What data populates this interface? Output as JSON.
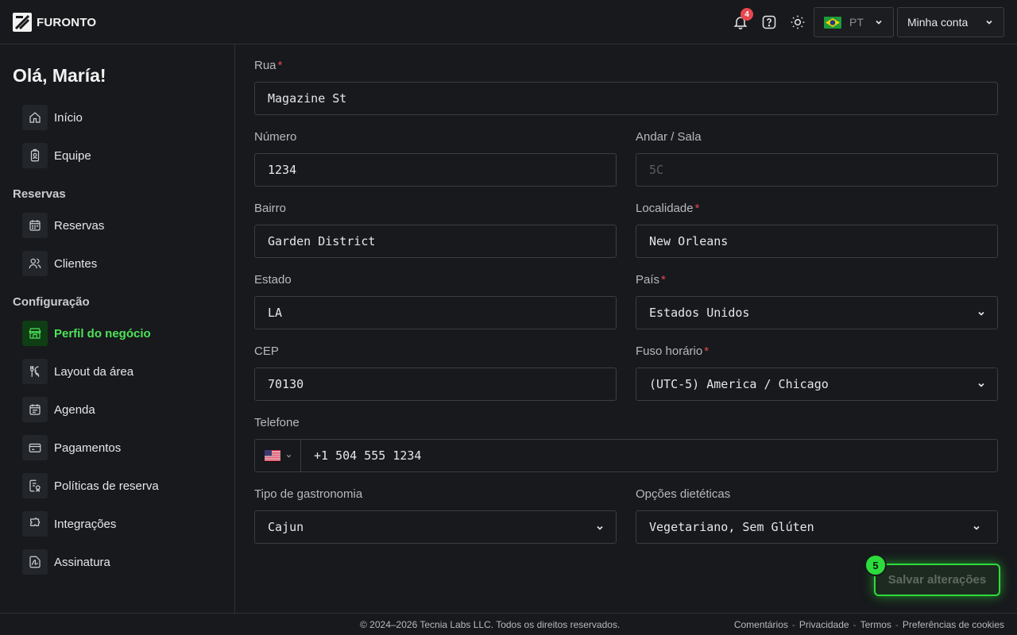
{
  "header": {
    "brand": "FURONTO",
    "notifications_count": "4",
    "language_code": "PT",
    "account_label": "Minha conta"
  },
  "sidebar": {
    "greeting": "Olá, María!",
    "items_top": [
      {
        "label": "Início",
        "icon": "home-icon"
      },
      {
        "label": "Equipe",
        "icon": "badge-icon"
      }
    ],
    "section_reservas": "Reservas",
    "items_reservas": [
      {
        "label": "Reservas",
        "icon": "calendar-icon"
      },
      {
        "label": "Clientes",
        "icon": "users-icon"
      }
    ],
    "section_config": "Configuração",
    "items_config": [
      {
        "label": "Perfil do negócio",
        "icon": "store-icon",
        "active": true
      },
      {
        "label": "Layout da área",
        "icon": "utensils-icon"
      },
      {
        "label": "Agenda",
        "icon": "schedule-icon"
      },
      {
        "label": "Pagamentos",
        "icon": "card-icon"
      },
      {
        "label": "Políticas de reserva",
        "icon": "policy-icon"
      },
      {
        "label": "Integrações",
        "icon": "puzzle-icon"
      },
      {
        "label": "Assinatura",
        "icon": "signature-icon"
      }
    ]
  },
  "form": {
    "street": {
      "label": "Rua",
      "value": "Magazine St",
      "required": true
    },
    "number": {
      "label": "Número",
      "value": "1234"
    },
    "floor": {
      "label": "Andar / Sala",
      "placeholder": "5C"
    },
    "neighborhood": {
      "label": "Bairro",
      "value": "Garden District"
    },
    "locality": {
      "label": "Localidade",
      "value": "New Orleans",
      "required": true
    },
    "state": {
      "label": "Estado",
      "value": "LA"
    },
    "country": {
      "label": "País",
      "value": "Estados Unidos",
      "required": true
    },
    "zip": {
      "label": "CEP",
      "value": "70130"
    },
    "timezone": {
      "label": "Fuso horário",
      "value": "(UTC-5) America / Chicago",
      "required": true
    },
    "phone": {
      "label": "Telefone",
      "value": "+1 504 555 1234",
      "country_flag": "us-flag"
    },
    "cuisine": {
      "label": "Tipo de gastronomia",
      "value": "Cajun"
    },
    "dietary": {
      "label": "Opções dietéticas",
      "value": "Vegetariano, Sem Glúten"
    }
  },
  "save": {
    "label": "Salvar alterações",
    "badge": "5"
  },
  "footer": {
    "copyright": "© 2024–2026 Tecnia Labs LLC. Todos os direitos reservados.",
    "links": [
      "Comentários",
      "Privacidade",
      "Termos",
      "Preferências de cookies"
    ]
  },
  "colors": {
    "accent": "#2ddc3b",
    "active_text": "#4ee35a",
    "required": "#e5484d",
    "background": "#17191c"
  }
}
